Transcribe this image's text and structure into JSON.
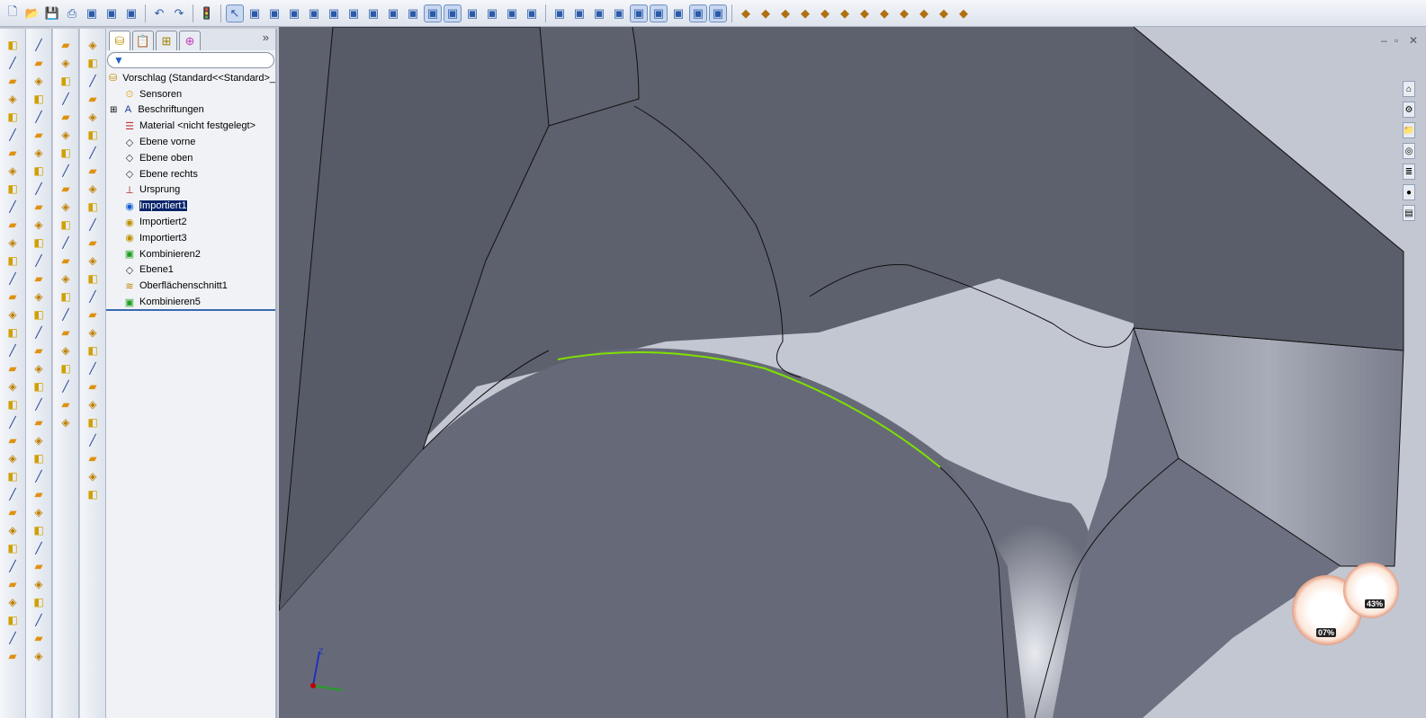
{
  "toolbar": {
    "icons": [
      "new-document-icon",
      "open-icon",
      "save-icon",
      "print-icon",
      "print-preview-icon",
      "file-properties-icon",
      "options-icon",
      "undo-icon",
      "redo-icon",
      "rebuild-icon",
      "select-icon",
      "view-front-icon",
      "view-back-icon",
      "view-left-icon",
      "view-right-icon",
      "view-top-icon",
      "view-bottom-icon",
      "view-iso-icon",
      "view-trimetric-icon",
      "view-dimetric-icon",
      "normal-to-icon",
      "shaded-with-edges-icon",
      "shaded-icon",
      "section-view-icon",
      "appearance-icon",
      "hide-show-icon",
      "sketch-icon",
      "smart-dimension-icon",
      "planes-icon",
      "axes-icon",
      "points-icon",
      "origins-icon",
      "sketches-icon",
      "annotations-icon",
      "lights-icon",
      "measure-icon",
      "mass-properties-icon",
      "section-properties-icon",
      "check-icon",
      "geometry-analysis-icon",
      "import-diagnostics-icon",
      "deviation-analysis-icon",
      "draft-analysis-icon",
      "thickness-analysis-icon",
      "zebra-stripes-icon",
      "curvature-icon",
      "symmetry-check-icon"
    ]
  },
  "tree": {
    "tabs": [
      "featuremanager-tab",
      "propertymanager-tab",
      "configurationmanager-tab",
      "dimxpert-tab"
    ],
    "more": "»",
    "filter_icon": "filter-icon",
    "root": "Vorschlag  (Standard<<Standard>_",
    "items": [
      {
        "label": "Sensoren",
        "icon": "sensors-folder-icon"
      },
      {
        "label": "Beschriftungen",
        "icon": "annotations-folder-icon",
        "expandable": true
      },
      {
        "label": "Material <nicht festgelegt>",
        "icon": "material-icon"
      },
      {
        "label": "Ebene vorne",
        "icon": "plane-icon"
      },
      {
        "label": "Ebene oben",
        "icon": "plane-icon"
      },
      {
        "label": "Ebene rechts",
        "icon": "plane-icon"
      },
      {
        "label": "Ursprung",
        "icon": "origin-icon"
      },
      {
        "label": "Importiert1",
        "icon": "imported-body-icon",
        "selected": true
      },
      {
        "label": "Importiert2",
        "icon": "imported-body-icon"
      },
      {
        "label": "Importiert3",
        "icon": "imported-body-icon"
      },
      {
        "label": "Kombinieren2",
        "icon": "combine-icon"
      },
      {
        "label": "Ebene1",
        "icon": "plane-icon"
      },
      {
        "label": "Oberflächenschnitt1",
        "icon": "surface-cut-icon"
      },
      {
        "label": "Kombinieren5",
        "icon": "combine-icon"
      }
    ]
  },
  "gauges": {
    "cpu": "07%",
    "memory": "43%"
  },
  "triad": {
    "z": "Z"
  },
  "colors": {
    "model": "#5f6370",
    "highlight": "#7fe000",
    "background": "#c3c7d2"
  }
}
